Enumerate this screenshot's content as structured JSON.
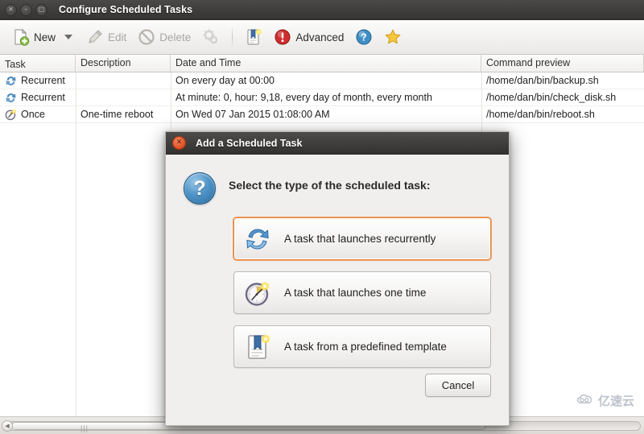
{
  "window": {
    "title": "Configure Scheduled Tasks",
    "controls": [
      {
        "name": "close",
        "glyph": "✕"
      },
      {
        "name": "minimize",
        "glyph": "–"
      },
      {
        "name": "maximize",
        "glyph": "□"
      }
    ]
  },
  "toolbar": {
    "new_label": "New",
    "edit_label": "Edit",
    "delete_label": "Delete",
    "advanced_label": "Advanced",
    "icons": {
      "new": "new-document-icon",
      "dropdown": "chevron-down-icon",
      "edit": "pencil-icon",
      "delete": "ban-icon",
      "gears": "gears-icon",
      "template": "template-document-icon",
      "advanced": "red-alert-icon",
      "help": "blue-help-icon",
      "favorite": "yellow-star-icon"
    }
  },
  "table": {
    "headers": [
      "Task",
      "Description",
      "Date and Time",
      "Command preview"
    ],
    "rows": [
      {
        "icon": "recurrent-icon",
        "task": "Recurrent",
        "description": "",
        "datetime": "On every day at 00:00",
        "command": "/home/dan/bin/backup.sh"
      },
      {
        "icon": "recurrent-icon",
        "task": "Recurrent",
        "description": "",
        "datetime": "At minute: 0, hour: 9,18, every day of month, every month",
        "command": "/home/dan/bin/check_disk.sh"
      },
      {
        "icon": "once-clock-icon",
        "task": "Once",
        "description": "One-time reboot",
        "datetime": "On Wed 07 Jan 2015 01:08:00 AM",
        "command": "/home/dan/bin/reboot.sh"
      }
    ]
  },
  "dialog": {
    "title": "Add a Scheduled Task",
    "close_glyph": "✕",
    "prompt": "Select the type of the scheduled task:",
    "options": [
      {
        "label": "A task that launches recurrently",
        "icon": "recycle-arrows-icon",
        "focused": true
      },
      {
        "label": "A task that launches one time",
        "icon": "clock-sparkle-icon",
        "focused": false
      },
      {
        "label": "A task from a predefined template",
        "icon": "bookmark-document-icon",
        "focused": false
      }
    ],
    "cancel_label": "Cancel"
  },
  "watermark": {
    "text": "亿速云",
    "icon": "cloud-icon"
  },
  "colors": {
    "titlebar": "#3f3d3b",
    "focus_orange": "#e8833a",
    "accent_blue": "#4f94c8",
    "alert_red": "#cf2e2e",
    "star_yellow": "#f5c73b"
  }
}
